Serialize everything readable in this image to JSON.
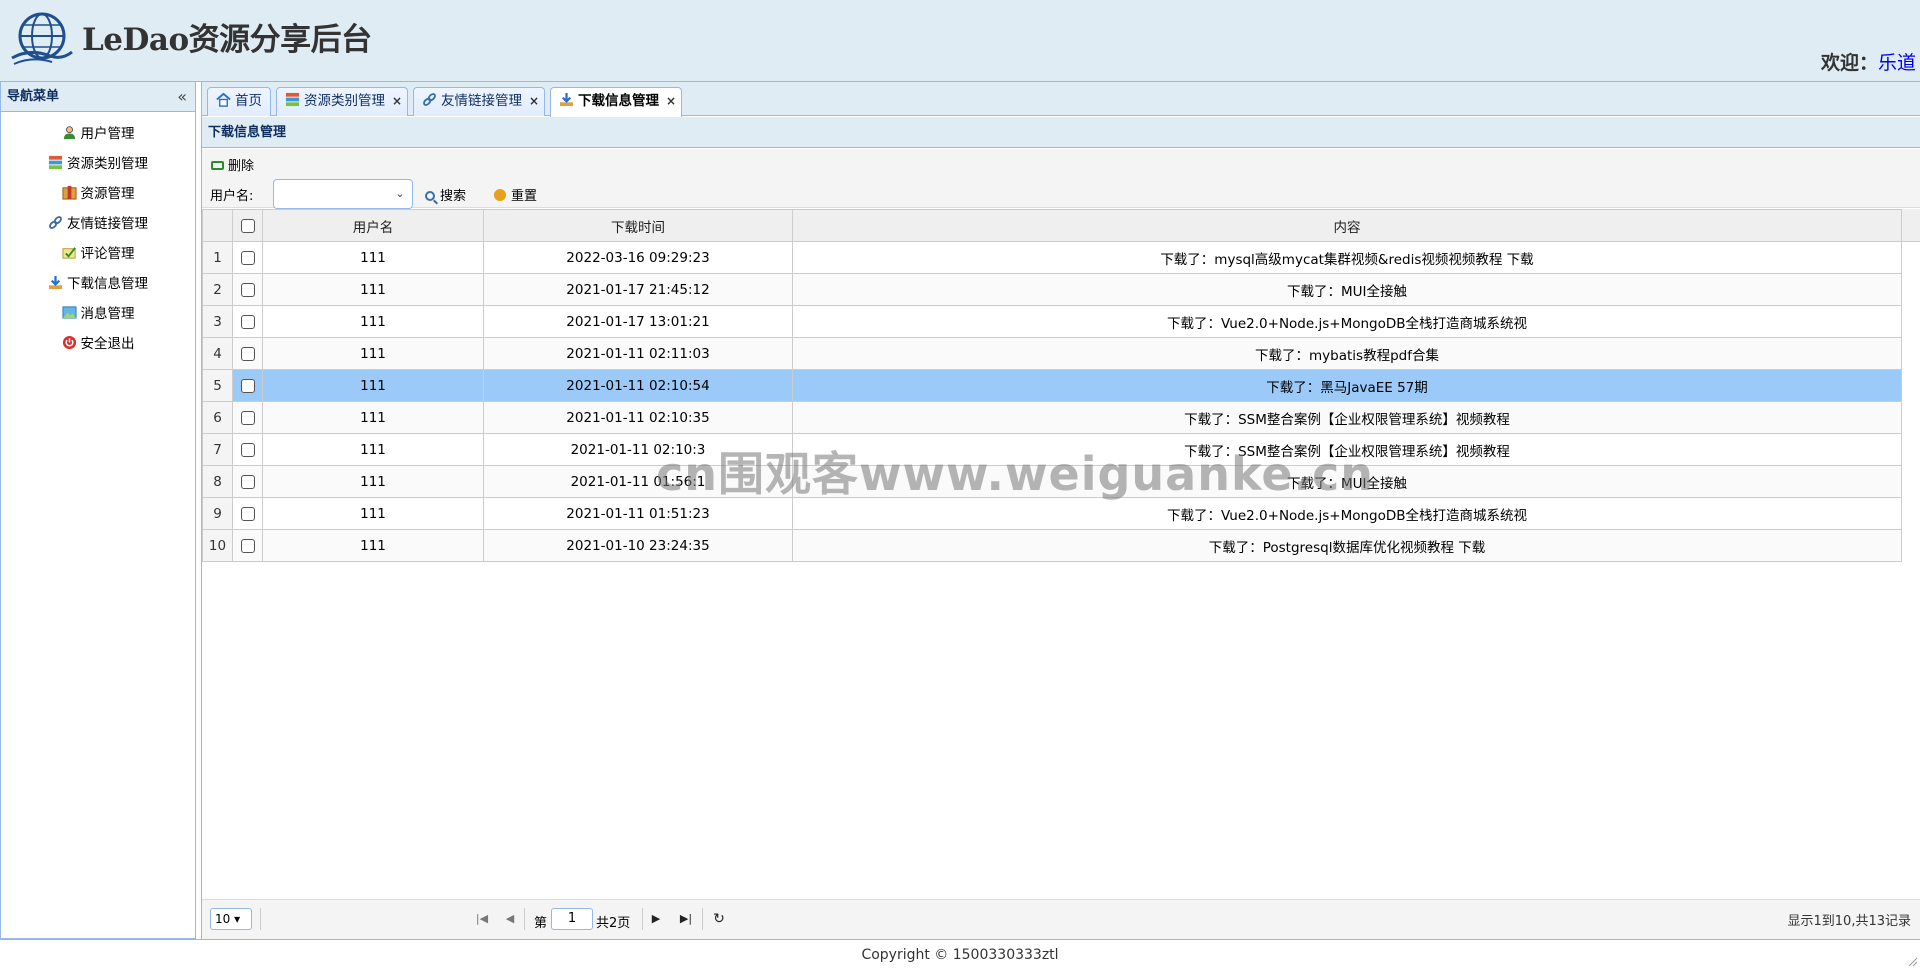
{
  "header": {
    "title": "LeDao资源分享后台",
    "welcome_label": "欢迎：",
    "welcome_user": "乐道"
  },
  "nav": {
    "title": "导航菜单",
    "collapse_glyph": "«",
    "items": [
      {
        "label": "用户管理",
        "icon": "user-icon"
      },
      {
        "label": "资源类别管理",
        "icon": "category-icon"
      },
      {
        "label": "资源管理",
        "icon": "resource-icon"
      },
      {
        "label": "友情链接管理",
        "icon": "link-icon"
      },
      {
        "label": "评论管理",
        "icon": "comment-icon"
      },
      {
        "label": "下载信息管理",
        "icon": "download-icon"
      },
      {
        "label": "消息管理",
        "icon": "message-icon"
      },
      {
        "label": "安全退出",
        "icon": "logout-icon"
      }
    ]
  },
  "tabs": [
    {
      "label": "首页",
      "closable": false,
      "icon": "home-icon"
    },
    {
      "label": "资源类别管理",
      "closable": true,
      "icon": "category-icon"
    },
    {
      "label": "友情链接管理",
      "closable": true,
      "icon": "link-icon"
    },
    {
      "label": "下载信息管理",
      "closable": true,
      "icon": "download-icon",
      "active": true
    }
  ],
  "panel": {
    "title": "下载信息管理",
    "delete_label": "删除",
    "search_label": "用户名:",
    "search_value": "",
    "search_button": "搜索",
    "reset_button": "重置"
  },
  "table": {
    "columns": [
      "用户名",
      "下载时间",
      "内容"
    ],
    "rows": [
      {
        "n": "1",
        "user": "111",
        "time": "2022-03-16 09:29:23",
        "content": "下载了：mysql高级mycat集群视频&redis视频视频教程 下载"
      },
      {
        "n": "2",
        "user": "111",
        "time": "2021-01-17 21:45:12",
        "content": "下载了：MUI全接触"
      },
      {
        "n": "3",
        "user": "111",
        "time": "2021-01-17 13:01:21",
        "content": "下载了：Vue2.0+Node.js+MongoDB全栈打造商城系统视"
      },
      {
        "n": "4",
        "user": "111",
        "time": "2021-01-11 02:11:03",
        "content": "下载了：mybatis教程pdf合集"
      },
      {
        "n": "5",
        "user": "111",
        "time": "2021-01-11 02:10:54",
        "content": "下载了：黑马JavaEE 57期",
        "selected": true
      },
      {
        "n": "6",
        "user": "111",
        "time": "2021-01-11 02:10:35",
        "content": "下载了：SSM整合案例【企业权限管理系统】视频教程"
      },
      {
        "n": "7",
        "user": "111",
        "time": "2021-01-11 02:10:3",
        "content": "下载了：SSM整合案例【企业权限管理系统】视频教程"
      },
      {
        "n": "8",
        "user": "111",
        "time": "2021-01-11 01:56:1",
        "content": "下载了：MUI全接触"
      },
      {
        "n": "9",
        "user": "111",
        "time": "2021-01-11 01:51:23",
        "content": "下载了：Vue2.0+Node.js+MongoDB全栈打造商城系统视"
      },
      {
        "n": "10",
        "user": "111",
        "time": "2021-01-10 23:24:35",
        "content": "下载了：Postgresql数据库优化视频教程 下载"
      }
    ]
  },
  "pager": {
    "page_size": "10",
    "page_prefix": "第",
    "page_value": "1",
    "page_total": "共2页",
    "info": "显示1到10,共13记录"
  },
  "footer": {
    "copyright": "Copyright © 1500330333ztl"
  },
  "watermark": "cn围观客www.weiguanke.cn",
  "colors": {
    "panel_header": "#e0ecf4",
    "border": "#95b8e7",
    "selected_row": "#9ccaf8",
    "link": "#0000ee"
  }
}
